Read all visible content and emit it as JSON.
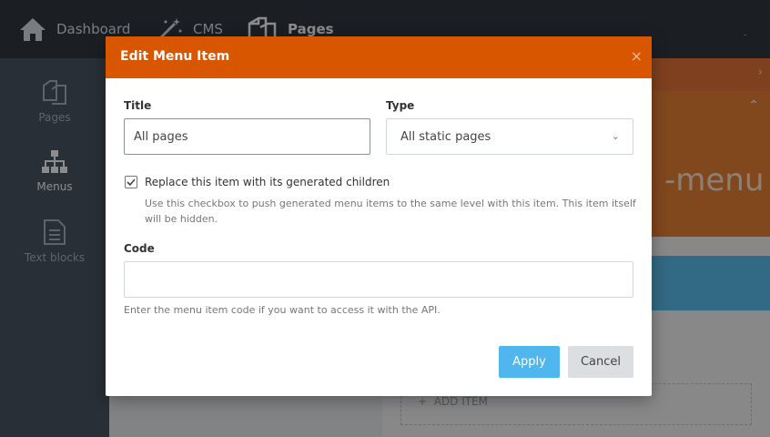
{
  "topnav": {
    "dashboard": "Dashboard",
    "cms": "CMS",
    "pages": "Pages"
  },
  "sidebar": {
    "items": [
      {
        "label": "Pages",
        "icon": "pages-icon"
      },
      {
        "label": "Menus",
        "icon": "sitemap-icon",
        "active": true
      },
      {
        "label": "Text blocks",
        "icon": "document-icon"
      }
    ]
  },
  "main": {
    "hero_title": "-menu",
    "add_item_label": "ADD ITEM"
  },
  "modal": {
    "title": "Edit Menu Item",
    "close": "×",
    "title_label": "Title",
    "title_value": "All pages",
    "type_label": "Type",
    "type_value": "All static pages",
    "replace_checked": true,
    "replace_label": "Replace this item with its generated children",
    "replace_help": "Use this checkbox to push generated menu items to the same level with this item. This item itself will be hidden.",
    "code_label": "Code",
    "code_value": "",
    "code_help": "Enter the menu item code if you want to access it with the API.",
    "apply_label": "Apply",
    "cancel_label": "Cancel"
  },
  "colors": {
    "modal_header": "#d95600",
    "apply_button": "#4fb6ee",
    "topbar": "#323a42",
    "sidebar": "#4a5663"
  }
}
